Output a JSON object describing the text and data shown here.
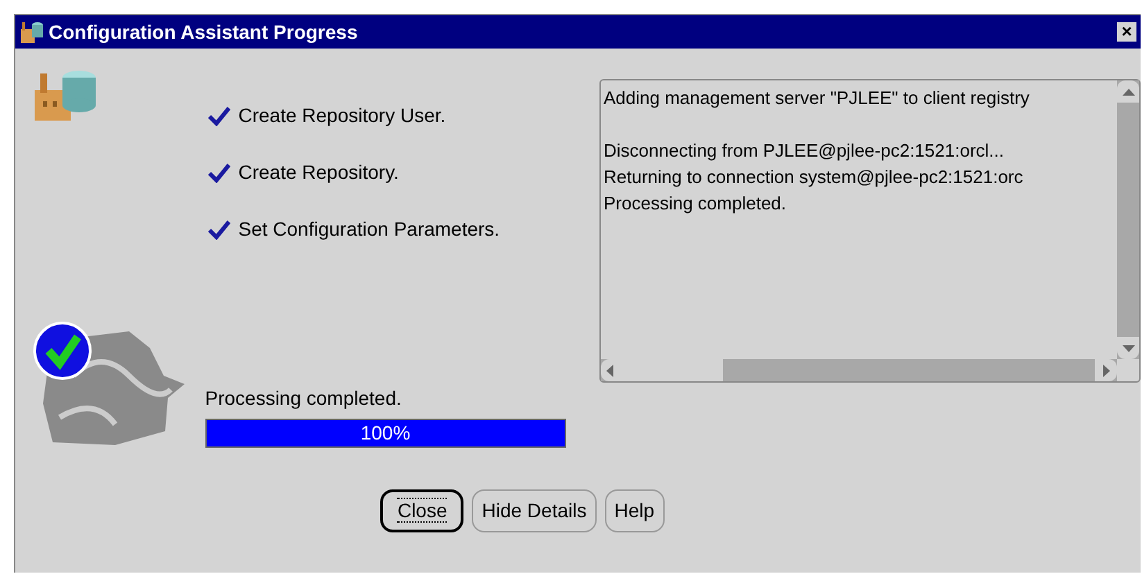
{
  "window": {
    "title": "Configuration Assistant Progress",
    "close_glyph": "×"
  },
  "steps": [
    {
      "label": "Create Repository User.",
      "done": true
    },
    {
      "label": "Create Repository.",
      "done": true
    },
    {
      "label": "Set Configuration Parameters.",
      "done": true
    }
  ],
  "progress": {
    "label": "Processing completed.",
    "level": 1,
    "reading": "100%"
  },
  "log": {
    "lines": [
      "Adding management server \"PJLEE\" to client registry",
      "Disconnecting from PJLEE@pjlee-pc2:1521:orcl...",
      "Returning to connection system@pjlee-pc2:1521:orc",
      "Processing completed."
    ]
  },
  "buttons": [
    {
      "label": "Close",
      "focused": true
    },
    {
      "label": "Hide Details",
      "focused": false
    },
    {
      "label": "Help",
      "focused": false
    }
  ]
}
